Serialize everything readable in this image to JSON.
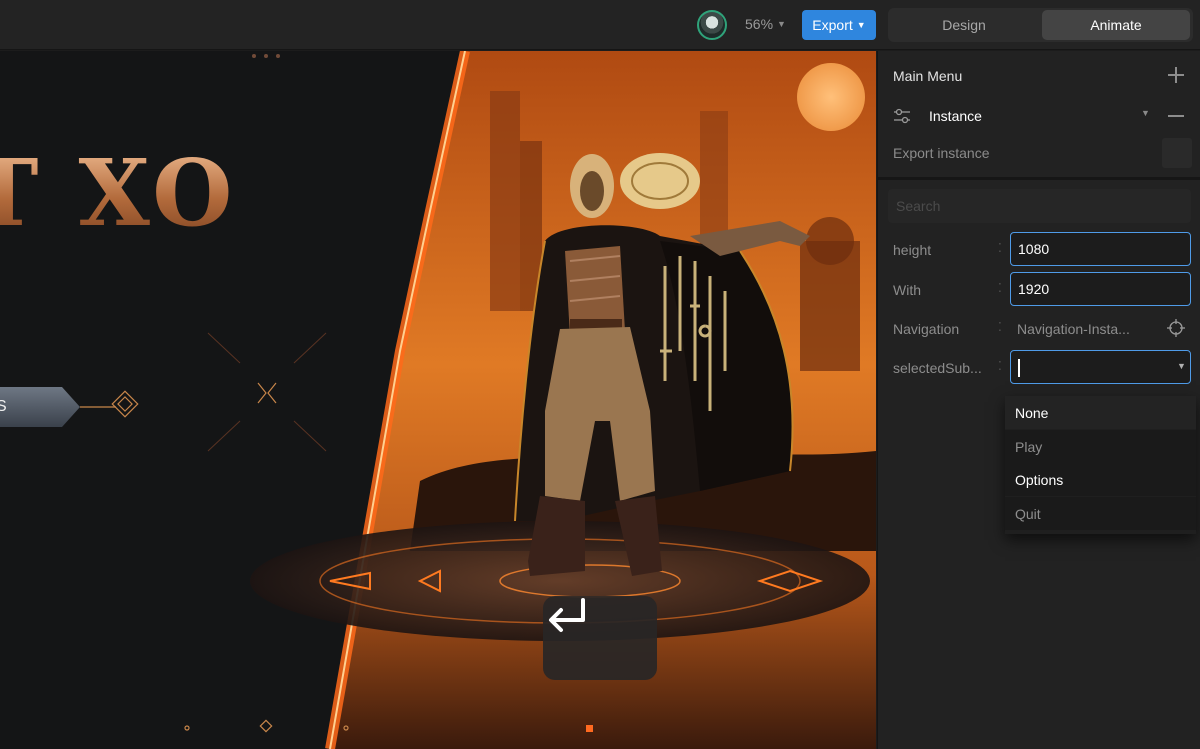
{
  "topbar": {
    "zoom": "56%",
    "export_label": "Export",
    "mode_tabs": [
      "Design",
      "Animate"
    ],
    "active_mode": "Animate"
  },
  "canvas": {
    "title_text": "T XO",
    "menu_button_text": "S"
  },
  "panel": {
    "section_title": "Main Menu",
    "instance_label": "Instance",
    "export_instance_label": "Export instance",
    "search_placeholder": "Search",
    "properties": {
      "height": {
        "label": "height",
        "value": "1080"
      },
      "width": {
        "label": "With",
        "value": "1920"
      },
      "navigation": {
        "label": "Navigation",
        "value": "Navigation-Insta..."
      },
      "selected_sub": {
        "label": "selectedSub...",
        "value": ""
      }
    },
    "dropdown_options": [
      "None",
      "Play",
      "Options",
      "Quit"
    ]
  },
  "colors": {
    "accent": "#2f86de",
    "focus_border": "#4f9be8",
    "panel_bg": "#222222",
    "canvas_orange": "#e8781f"
  },
  "icons": [
    "avatar",
    "chevron-down-icon",
    "plus-icon",
    "sliders-icon",
    "minus-icon",
    "target-icon",
    "return-arrow-icon"
  ]
}
